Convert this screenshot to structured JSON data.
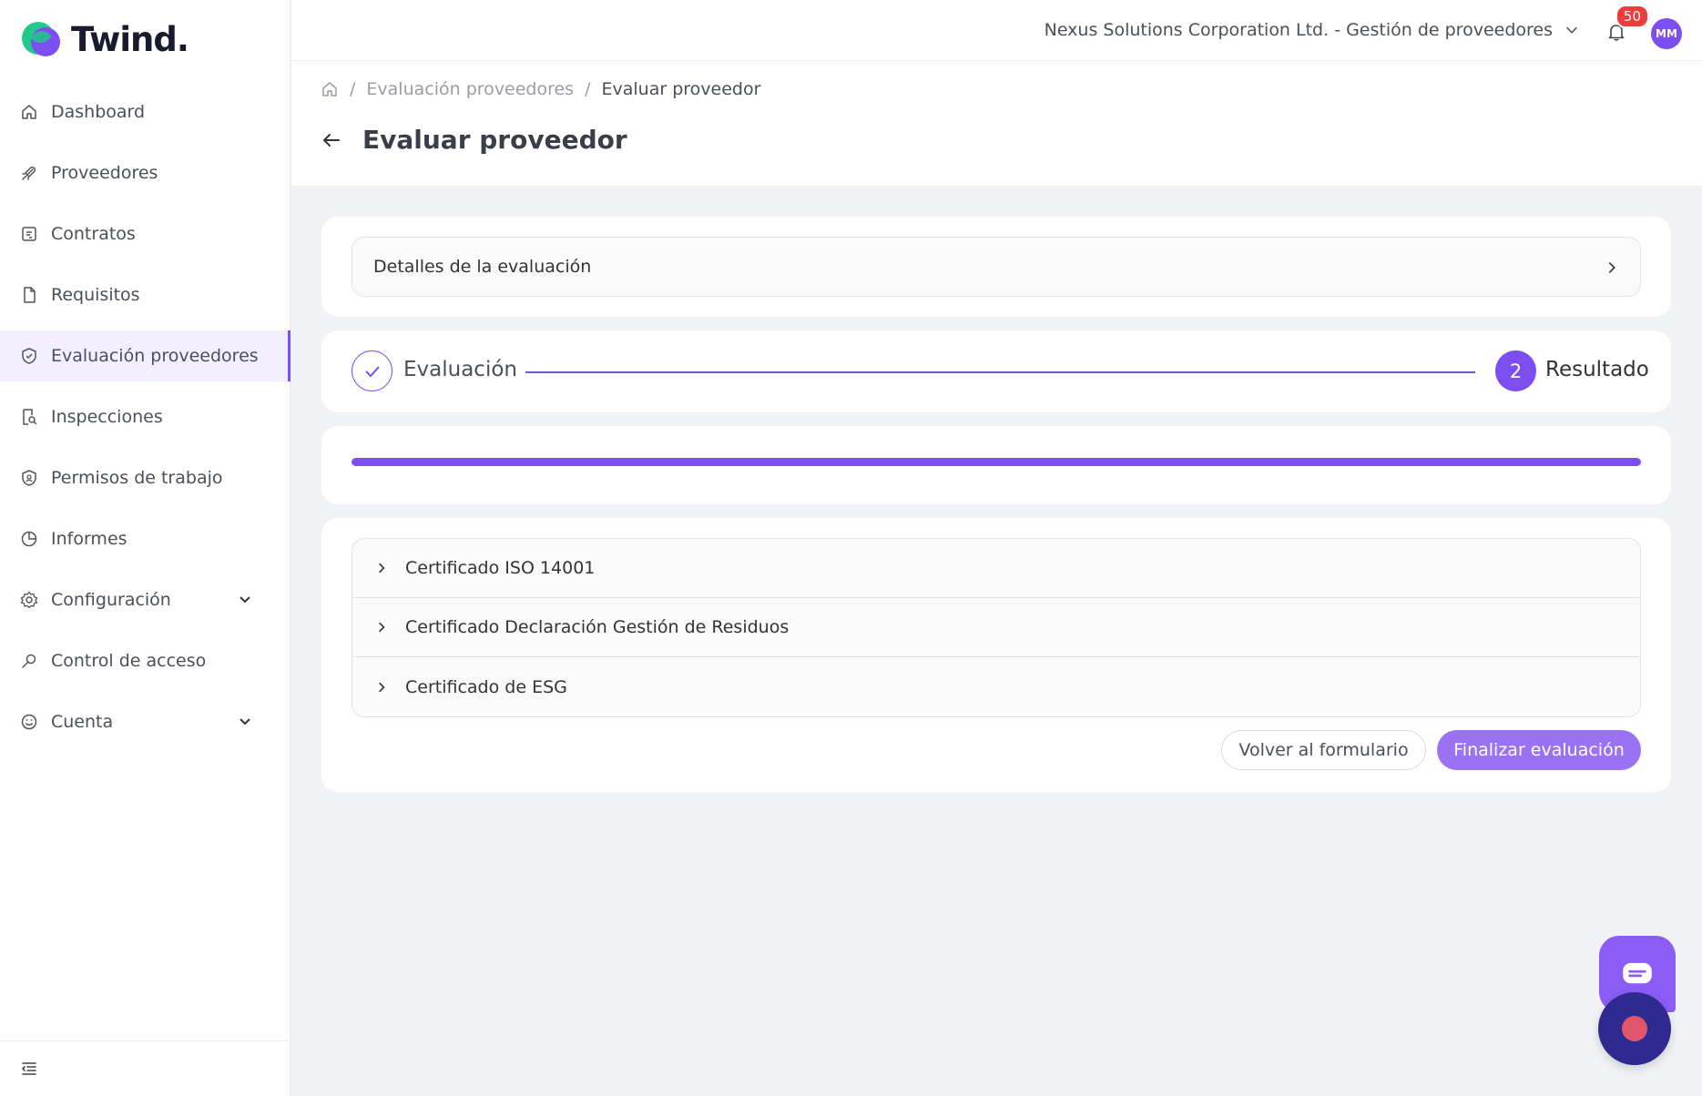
{
  "brand": {
    "name": "Twind.",
    "primary_color": "#7c4df0",
    "accent_green": "#22c98a"
  },
  "sidebar": {
    "items": [
      {
        "label": "Dashboard",
        "icon": "home-icon"
      },
      {
        "label": "Proveedores",
        "icon": "rocket-icon"
      },
      {
        "label": "Contratos",
        "icon": "contract-icon"
      },
      {
        "label": "Requisitos",
        "icon": "document-icon"
      },
      {
        "label": "Evaluación proveedores",
        "icon": "shield-check-icon",
        "active": true
      },
      {
        "label": "Inspecciones",
        "icon": "inspection-icon"
      },
      {
        "label": "Permisos de trabajo",
        "icon": "shield-badge-icon"
      },
      {
        "label": "Informes",
        "icon": "pie-chart-icon"
      },
      {
        "label": "Configuración",
        "icon": "gear-icon",
        "expandable": true
      },
      {
        "label": "Control de acceso",
        "icon": "key-icon"
      },
      {
        "label": "Cuenta",
        "icon": "smile-icon",
        "expandable": true
      }
    ],
    "collapse_icon": "collapse-menu-icon"
  },
  "topbar": {
    "company": "Nexus Solutions Corporation Ltd. - Gestión de proveedores",
    "notifications_count": "50",
    "avatar_initials": "MM"
  },
  "breadcrumb": {
    "home_icon": "home-icon",
    "items": [
      "Evaluación proveedores",
      "Evaluar proveedor"
    ]
  },
  "page": {
    "title": "Evaluar proveedor"
  },
  "details": {
    "label": "Detalles de la evaluación"
  },
  "stepper": {
    "steps": [
      {
        "label": "Evaluación",
        "state": "completed"
      },
      {
        "number": "2",
        "label": "Resultado",
        "state": "current"
      }
    ]
  },
  "progress": {
    "fraction": 1.0
  },
  "certificates": [
    "Certificado ISO 14001",
    "Certificado Declaración Gestión de Residuos",
    "Certificado de ESG"
  ],
  "actions": {
    "back_label": "Volver al formulario",
    "finish_label": "Finalizar evaluación"
  }
}
